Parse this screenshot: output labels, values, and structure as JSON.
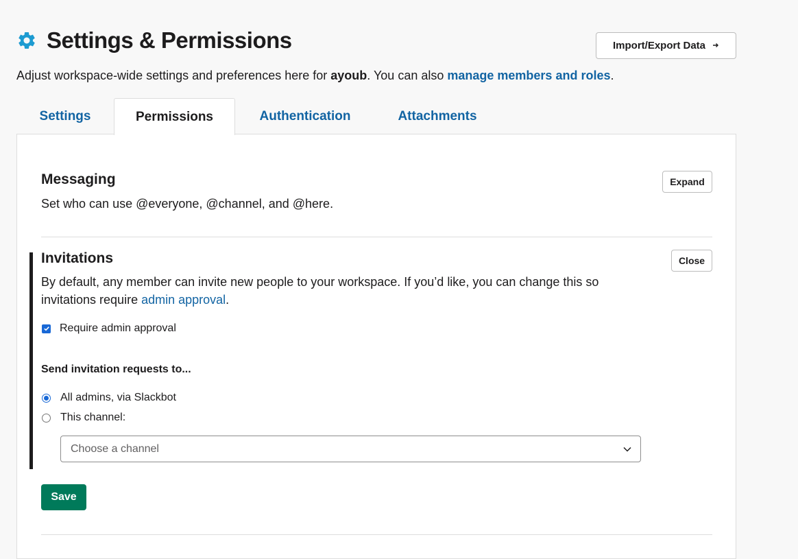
{
  "page": {
    "title": "Settings & Permissions",
    "import_export_label": "Import/Export Data",
    "subtitle_prefix": "Adjust workspace-wide settings and preferences here for ",
    "workspace_name": "ayoub",
    "subtitle_middle": ". You can also ",
    "subtitle_link": "manage members and roles",
    "subtitle_suffix": "."
  },
  "tabs": [
    {
      "label": "Settings",
      "active": false
    },
    {
      "label": "Permissions",
      "active": true
    },
    {
      "label": "Authentication",
      "active": false
    },
    {
      "label": "Attachments",
      "active": false
    }
  ],
  "messaging": {
    "title": "Messaging",
    "description": "Set who can use @everyone, @channel, and @here.",
    "expand_label": "Expand"
  },
  "invitations": {
    "title": "Invitations",
    "close_label": "Close",
    "description_line1": "By default, any member can invite new people to your workspace. If you’d like, you can change this so",
    "description_line2_prefix": "invitations require ",
    "description_link": "admin approval",
    "description_suffix": ".",
    "require_approval_label": "Require admin approval",
    "require_approval_checked": true,
    "send_requests_heading": "Send invitation requests to...",
    "options": [
      {
        "label": "All admins, via Slackbot",
        "checked": true
      },
      {
        "label": "This channel:",
        "checked": false
      }
    ],
    "channel_select_placeholder": "Choose a channel",
    "save_label": "Save"
  },
  "colors": {
    "accent_link": "#1264a3",
    "gear_icon": "#1d9bd1",
    "save_button": "#007a5a",
    "checkbox": "#1868d6"
  }
}
